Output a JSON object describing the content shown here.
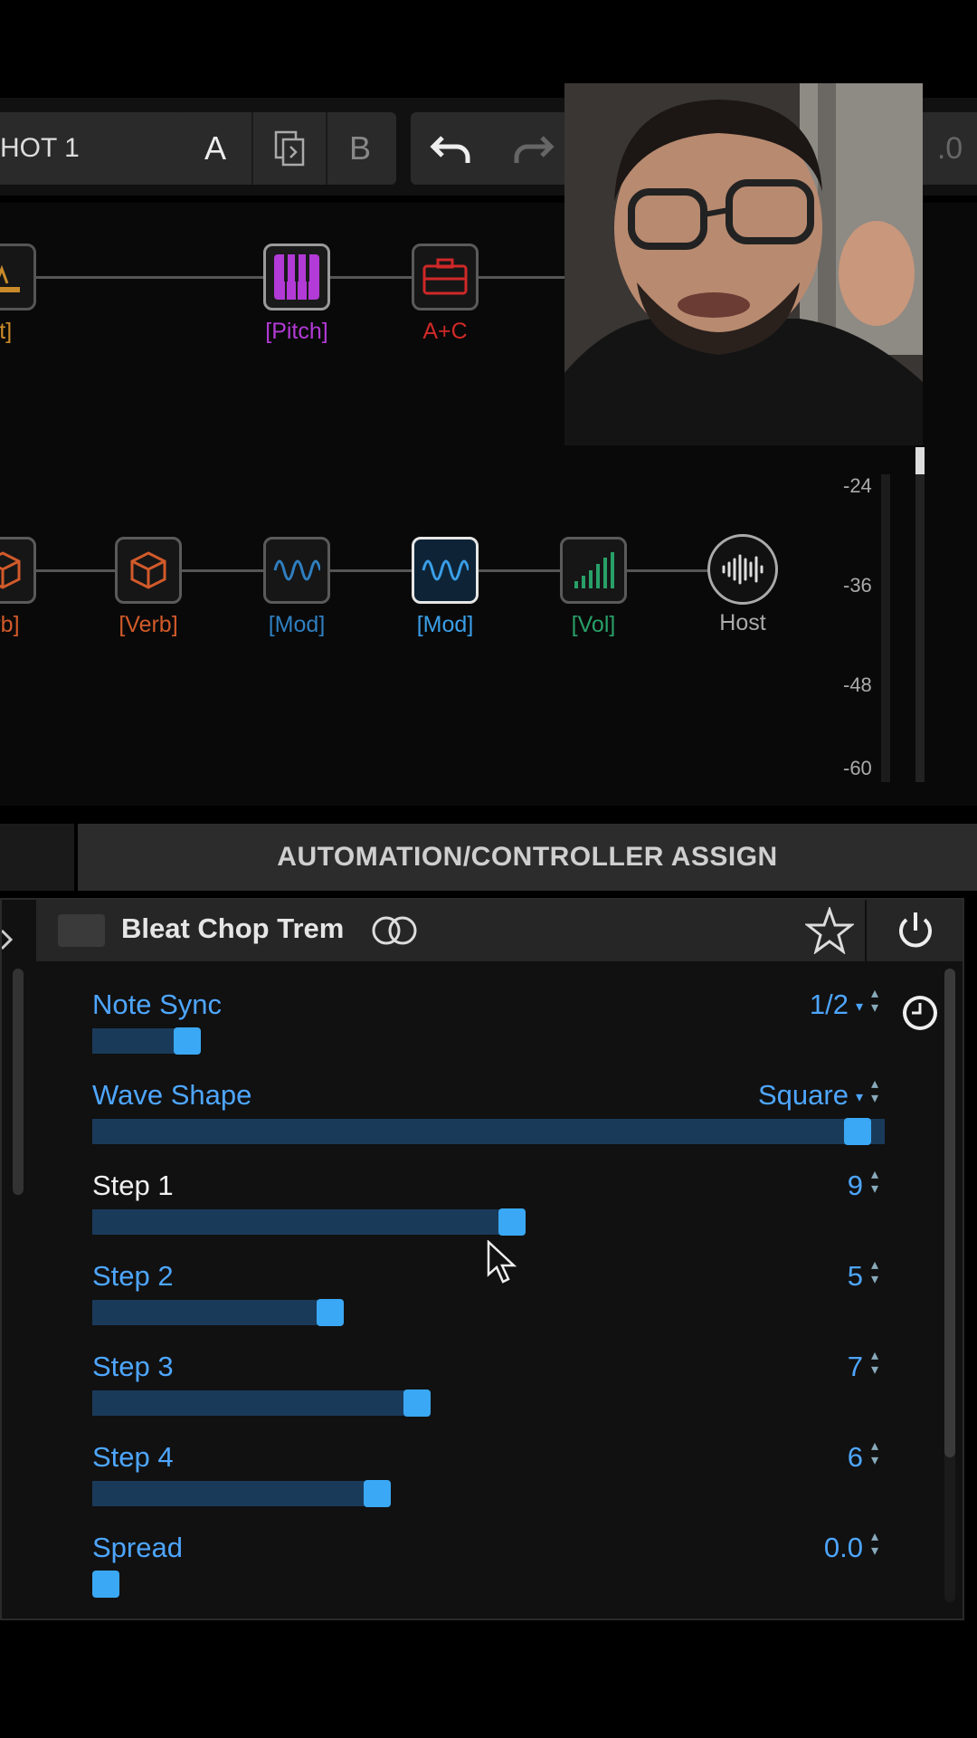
{
  "toolbar": {
    "snapshot_label": "HOT 1",
    "a_label": "A",
    "b_label": "B",
    "right_value": ".0"
  },
  "chain": {
    "row1": [
      {
        "label": "st]",
        "color": "#c98a2a",
        "icon": "amp-icon"
      },
      {
        "label": "[Pitch]",
        "color": "#b23ad6",
        "icon": "piano-icon"
      },
      {
        "label": "A+C",
        "color": "#d02828",
        "icon": "cab-icon"
      }
    ],
    "row2": [
      {
        "label": "erb]",
        "color": "#d25a2a",
        "icon": "cube-icon"
      },
      {
        "label": "[Verb]",
        "color": "#d25a2a",
        "icon": "cube-icon"
      },
      {
        "label": "[Mod]",
        "color": "#2f7fc0",
        "icon": "wave-icon"
      },
      {
        "label": "[Mod]",
        "color": "#3a9fe8",
        "icon": "wave-icon"
      },
      {
        "label": "[Vol]",
        "color": "#28a068",
        "icon": "volume-icon"
      },
      {
        "label": "Host",
        "color": "#aaaaaa",
        "icon": "waveform-icon"
      }
    ]
  },
  "meter": {
    "labels": [
      "-24",
      "-36",
      "-48",
      "-60"
    ]
  },
  "automation_tab": "AUTOMATION/CONTROLLER ASSIGN",
  "model": {
    "name": "Bleat Chop Trem"
  },
  "params": [
    {
      "name": "Note Sync",
      "value": "1/2",
      "dropdown": true,
      "level": 0.12
    },
    {
      "name": "Wave Shape",
      "value": "Square",
      "dropdown": true,
      "level": 1.0
    },
    {
      "name": "Step 1",
      "value": "9",
      "dropdown": false,
      "level": 0.53
    },
    {
      "name": "Step 2",
      "value": "5",
      "dropdown": false,
      "level": 0.3
    },
    {
      "name": "Step 3",
      "value": "7",
      "dropdown": false,
      "level": 0.41
    },
    {
      "name": "Step 4",
      "value": "6",
      "dropdown": false,
      "level": 0.36
    },
    {
      "name": "Spread",
      "value": "0.0",
      "dropdown": false,
      "level": 0.0
    }
  ]
}
